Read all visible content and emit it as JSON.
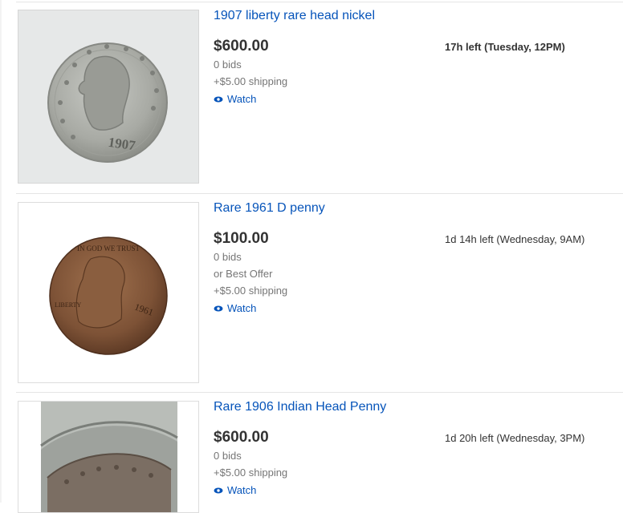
{
  "listings": [
    {
      "title": "1907 liberty rare head nickel",
      "price": "$600.00",
      "time_left": "17h left (Tuesday, 12PM)",
      "bids": "0 bids",
      "best_offer": "",
      "shipping": "+$5.00 shipping",
      "watch_label": "Watch",
      "coin_year": "1907"
    },
    {
      "title": "Rare 1961 D penny",
      "price": "$100.00",
      "time_left": "1d 14h left (Wednesday, 9AM)",
      "bids": "0 bids",
      "best_offer": "or Best Offer",
      "shipping": "+$5.00 shipping",
      "watch_label": "Watch",
      "coin_year": "1961",
      "coin_motto": "IN GOD WE TRUST",
      "coin_liberty": "LIBERTY"
    },
    {
      "title": "Rare 1906 Indian Head Penny",
      "price": "$600.00",
      "time_left": "1d 20h left (Wednesday, 3PM)",
      "bids": "0 bids",
      "best_offer": "",
      "shipping": "+$5.00 shipping",
      "watch_label": "Watch"
    }
  ],
  "colors": {
    "link": "#0654ba",
    "price": "#333333",
    "secondary_text": "#767676"
  },
  "icons": {
    "watch": "eye-icon"
  }
}
